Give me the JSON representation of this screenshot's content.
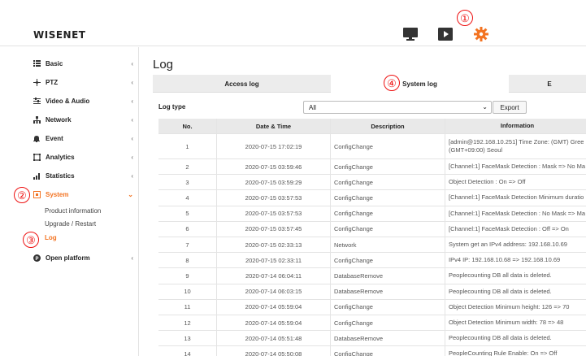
{
  "header": {
    "logo": "WISENET",
    "icons": [
      "monitor-icon",
      "play-icon",
      "gear-icon"
    ],
    "markers": [
      "①",
      "②",
      "③",
      "④"
    ]
  },
  "sidebar": {
    "items": [
      {
        "label": "Basic",
        "icon": "list-icon"
      },
      {
        "label": "PTZ",
        "icon": "move-icon"
      },
      {
        "label": "Video & Audio",
        "icon": "sliders-icon"
      },
      {
        "label": "Network",
        "icon": "network-icon"
      },
      {
        "label": "Event",
        "icon": "bell-icon"
      },
      {
        "label": "Analytics",
        "icon": "analytics-icon"
      },
      {
        "label": "Statistics",
        "icon": "chart-icon"
      },
      {
        "label": "System",
        "icon": "system-icon"
      },
      {
        "label": "Open platform",
        "icon": "platform-icon"
      }
    ],
    "sub_items": [
      "Product information",
      "Upgrade / Restart",
      "Log"
    ]
  },
  "main": {
    "title": "Log",
    "tabs": [
      "Access log",
      "System log",
      "E"
    ],
    "log_type_label": "Log type",
    "log_type_value": "All",
    "export_label": "Export",
    "table": {
      "headers": [
        "No.",
        "Date & Time",
        "Description",
        "Information"
      ],
      "rows": [
        [
          "1",
          "2020-07-15 17:02:19",
          "ConfigChange",
          "[admin@192.168.10.251] Time Zone: (GMT) Gree (GMT+09:00) Seoul"
        ],
        [
          "2",
          "2020-07-15 03:59:46",
          "ConfigChange",
          "[Channel:1] FaceMask Detection : Mask => No Ma"
        ],
        [
          "3",
          "2020-07-15 03:59:29",
          "ConfigChange",
          "Object Detection : On => Off"
        ],
        [
          "4",
          "2020-07-15 03:57:53",
          "ConfigChange",
          "[Channel:1] FaceMask Detection Minimum duratio"
        ],
        [
          "5",
          "2020-07-15 03:57:53",
          "ConfigChange",
          "[Channel:1] FaceMask Detection : No Mask => Ma"
        ],
        [
          "6",
          "2020-07-15 03:57:45",
          "ConfigChange",
          "[Channel:1] FaceMask Detection : Off => On"
        ],
        [
          "7",
          "2020-07-15 02:33:13",
          "Network",
          "System get an IPv4 address: 192.168.10.69"
        ],
        [
          "8",
          "2020-07-15 02:33:11",
          "ConfigChange",
          "IPv4 IP: 192.168.10.68 => 192.168.10.69"
        ],
        [
          "9",
          "2020-07-14 06:04:11",
          "DatabaseRemove",
          "Peoplecounting DB all data is deleted."
        ],
        [
          "10",
          "2020-07-14 06:03:15",
          "DatabaseRemove",
          "Peoplecounting DB all data is deleted."
        ],
        [
          "11",
          "2020-07-14 05:59:04",
          "ConfigChange",
          "Object Detection Minimum height: 126 => 70"
        ],
        [
          "12",
          "2020-07-14 05:59:04",
          "ConfigChange",
          "Object Detection Minimum width: 78 => 48"
        ],
        [
          "13",
          "2020-07-14 05:51:48",
          "DatabaseRemove",
          "Peoplecounting DB all data is deleted."
        ],
        [
          "14",
          "2020-07-14 05:50:08",
          "ConfigChange",
          "PeopleCounting Rule Enable: On => Off"
        ]
      ]
    }
  },
  "colors": {
    "accent": "#f37321",
    "marker": "#e11111"
  }
}
